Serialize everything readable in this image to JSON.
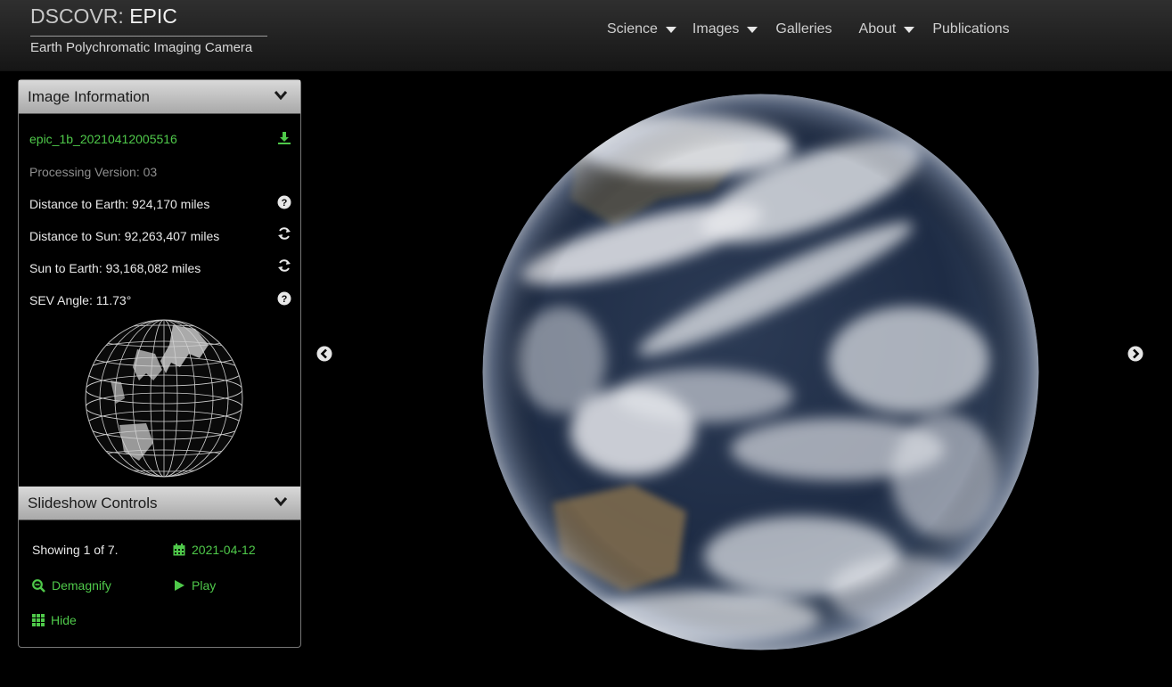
{
  "header": {
    "brand_prefix": "DSCOVR:",
    "brand_name": "EPIC",
    "subtitle": "Earth Polychromatic Imaging Camera",
    "nav": [
      {
        "label": "Science",
        "dropdown": true
      },
      {
        "label": "Images",
        "dropdown": true
      },
      {
        "label": "Galleries",
        "dropdown": false
      },
      {
        "label": "About",
        "dropdown": true
      },
      {
        "label": "Publications",
        "dropdown": false
      }
    ]
  },
  "image_info": {
    "title": "Image Information",
    "filename": "epic_1b_20210412005516",
    "processing_version": "Processing Version: 03",
    "distance_to_earth": "Distance to Earth: 924,170 miles",
    "distance_to_sun": "Distance to Sun: 92,263,407 miles",
    "sun_to_earth": "Sun to Earth: 93,168,082 miles",
    "sev_angle": "SEV Angle: 11.73°"
  },
  "slideshow": {
    "title": "Slideshow Controls",
    "showing": "Showing 1 of 7.",
    "date": "2021-04-12",
    "demagnify_label": "Demagnify",
    "play_label": "Play",
    "hide_label": "Hide"
  },
  "colors": {
    "accent_green": "#4fc94a",
    "header_bg": "#1f1f1f",
    "panel_header": "#c4c4c4"
  },
  "icons": [
    "download-icon",
    "help-icon",
    "refresh-icon",
    "chevron-down-icon",
    "calendar-icon",
    "zoom-out-icon",
    "play-icon",
    "grid-icon",
    "arrow-left-icon",
    "arrow-right-icon"
  ]
}
